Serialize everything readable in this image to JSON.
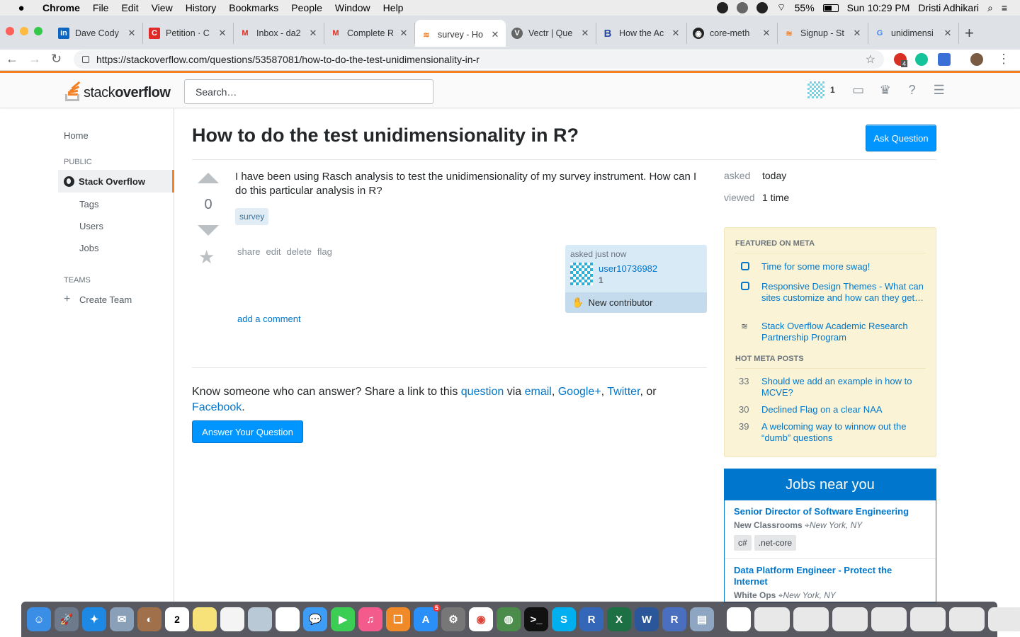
{
  "menubar": {
    "items": [
      "Chrome",
      "File",
      "Edit",
      "View",
      "History",
      "Bookmarks",
      "People",
      "Window",
      "Help"
    ],
    "battery": "55%",
    "clock": "Sun 10:29 PM",
    "user": "Dristi Adhikari"
  },
  "tabs": [
    {
      "title": "Dave Cody",
      "icon": "linkedin-icon"
    },
    {
      "title": "Petition · C",
      "icon": "change-org-icon"
    },
    {
      "title": "Inbox - da2",
      "icon": "gmail-icon"
    },
    {
      "title": "Complete R",
      "icon": "gmail-icon"
    },
    {
      "title": "survey - Ho",
      "icon": "stackoverflow-icon",
      "active": true
    },
    {
      "title": "Vectr | Que",
      "icon": "vectr-icon"
    },
    {
      "title": "How the Ac",
      "icon": "bold-b-icon"
    },
    {
      "title": "core-meth",
      "icon": "github-icon"
    },
    {
      "title": "Signup - St",
      "icon": "stackoverflow-icon"
    },
    {
      "title": "unidimensi",
      "icon": "google-icon"
    }
  ],
  "address_bar": {
    "url": "https://stackoverflow.com/questions/53587081/how-to-do-the-test-unidimensionality-in-r",
    "extension_badge": "4"
  },
  "so_header": {
    "logo_light": "stack",
    "logo_bold": "overflow",
    "search_placeholder": "Search…",
    "reputation": "1"
  },
  "leftnav": {
    "home": "Home",
    "public_label": "PUBLIC",
    "stackoverflow": "Stack Overflow",
    "tags": "Tags",
    "users": "Users",
    "jobs": "Jobs",
    "teams_label": "TEAMS",
    "create_team": "Create Team"
  },
  "question": {
    "title": "How to do the test unidimensionality in R?",
    "ask_button": "Ask Question",
    "votes": "0",
    "body": "I have been using Rasch analysis to test the unidimensionality of my survey instrument. How can I do this particular analysis in R?",
    "tag": "survey",
    "menu": [
      "share",
      "edit",
      "delete",
      "flag"
    ],
    "asked_label": "asked just now",
    "user_name": "user10736982",
    "user_rep": "1",
    "new_contributor": "New contributor",
    "add_comment": "add a comment"
  },
  "share": {
    "text_before": "Know someone who can answer? Share a link to this ",
    "question_link": "question",
    "via": " via ",
    "email": "email",
    "comma1": ", ",
    "google": "Google+",
    "comma2": ", ",
    "twitter": "Twitter",
    "or": ", or ",
    "facebook": "Facebook",
    "period": ".",
    "answer_button": "Answer Your Question"
  },
  "stats": {
    "asked_label": "asked",
    "asked_value": "today",
    "viewed_label": "viewed",
    "viewed_value": "1 time"
  },
  "featured": {
    "header": "FEATURED ON META",
    "items": [
      "Time for some more swag!",
      "Responsive Design Themes - What can sites customize and how can they get…",
      "Stack Overflow Academic Research Partnership Program"
    ],
    "hot_header": "HOT META POSTS",
    "hot": [
      {
        "count": "33",
        "title": "Should we add an example in how to MCVE?"
      },
      {
        "count": "30",
        "title": "Declined Flag on a clear NAA"
      },
      {
        "count": "39",
        "title": "A welcoming way to winnow out the “dumb” questions"
      }
    ]
  },
  "jobs": {
    "header": "Jobs near you",
    "list": [
      {
        "title": "Senior Director of Software Engineering",
        "company": "New Classrooms",
        "location": "New York, NY",
        "tags": [
          "c#",
          ".net-core"
        ]
      },
      {
        "title": "Data Platform Engineer - Protect the Internet",
        "company": "White Ops",
        "location": "New York, NY"
      }
    ]
  },
  "dock": {
    "calendar_day": "2",
    "appstore_badge": "5"
  }
}
